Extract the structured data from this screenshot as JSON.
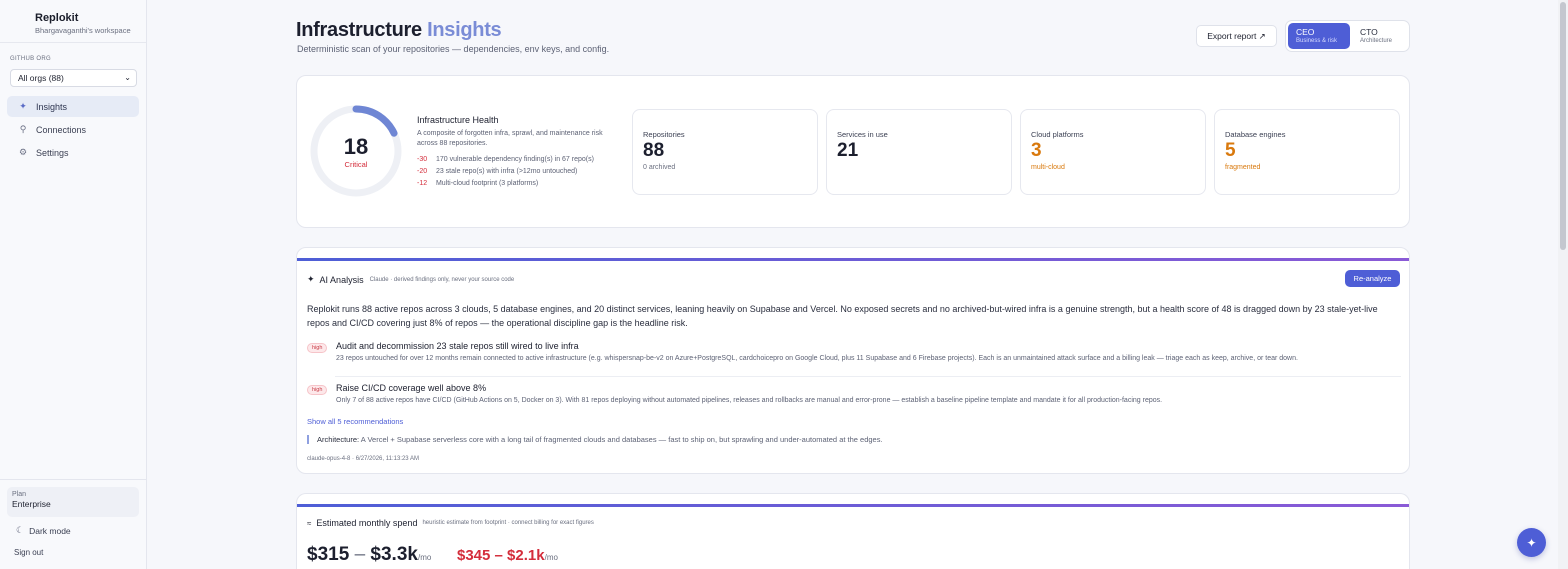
{
  "sidebar": {
    "brand_name": "Replokit",
    "workspace": "Bhargavaganthi's workspace",
    "org_label": "GITHUB ORG",
    "org_selected": "All orgs (88)",
    "nav": [
      {
        "label": "Insights",
        "icon": "sparkle-icon"
      },
      {
        "label": "Connections",
        "icon": "plug-icon"
      },
      {
        "label": "Settings",
        "icon": "gear-icon"
      }
    ],
    "plan_label": "Plan",
    "plan_value": "Enterprise",
    "dark_mode": "Dark mode",
    "sign_out": "Sign out"
  },
  "header": {
    "title_main": "Infrastructure",
    "title_accent": "Insights",
    "subtitle": "Deterministic scan of your repositories — dependencies, env keys, and config.",
    "export_label": "Export report ↗",
    "roles": [
      {
        "title": "CEO",
        "sub": "Business & risk",
        "active": true
      },
      {
        "title": "CTO",
        "sub": "Architecture",
        "active": false
      }
    ]
  },
  "health": {
    "score": 18,
    "score_max": 100,
    "status": "Critical",
    "title": "Infrastructure Health",
    "description": "A composite of forgotten infra, sprawl, and maintenance risk across 88 repositories.",
    "penalties": [
      {
        "points": "-30",
        "text": "170 vulnerable dependency finding(s) in 67 repo(s)"
      },
      {
        "points": "-20",
        "text": "23 stale repo(s) with infra (>12mo untouched)"
      },
      {
        "points": "-12",
        "text": "Multi-cloud footprint (3 platforms)"
      }
    ],
    "stats": [
      {
        "label": "Repositories",
        "value": "88",
        "note": "0 archived",
        "warn": false
      },
      {
        "label": "Services in use",
        "value": "21",
        "note": "",
        "warn": false
      },
      {
        "label": "Cloud platforms",
        "value": "3",
        "note": "multi-cloud",
        "warn": true
      },
      {
        "label": "Database engines",
        "value": "5",
        "note": "fragmented",
        "warn": true
      }
    ],
    "colors": {
      "critical": "#d42d3b",
      "gauge": "#6f86d4",
      "warn": "#d9790d"
    }
  },
  "ai": {
    "title": "AI Analysis",
    "subtitle": "Claude · derived findings only, never your source code",
    "reanalyze_label": "Re-analyze",
    "summary": "Replokit runs 88 active repos across 3 clouds, 5 database engines, and 20 distinct services, leaning heavily on Supabase and Vercel. No exposed secrets and no archived-but-wired infra is a genuine strength, but a health score of 48 is dragged down by 23 stale-yet-live repos and CI/CD covering just 8% of repos — the operational discipline gap is the headline risk.",
    "recommendations": [
      {
        "priority": "high",
        "title": "Audit and decommission 23 stale repos still wired to live infra",
        "detail": "23 repos untouched for over 12 months remain connected to active infrastructure (e.g. whispersnap-be-v2 on Azure+PostgreSQL, cardchoicepro on Google Cloud, plus 11 Supabase and 6 Firebase projects). Each is an unmaintained attack surface and a billing leak — triage each as keep, archive, or tear down."
      },
      {
        "priority": "high",
        "title": "Raise CI/CD coverage well above 8%",
        "detail": "Only 7 of 88 active repos have CI/CD (GitHub Actions on 5, Docker on 3). With 81 repos deploying without automated pipelines, releases and rollbacks are manual and error-prone — establish a baseline pipeline template and mandate it for all production-facing repos."
      }
    ],
    "show_all": "Show all 5 recommendations",
    "arch_label": "Architecture:",
    "arch_text": "A Vercel + Supabase serverless core with a long tail of fragmented clouds and databases — fast to ship on, but sprawling and under-automated at the edges.",
    "meta": "claude-opus-4-8 · 6/27/2026, 11:13:23 AM"
  },
  "spend": {
    "title": "Estimated monthly spend",
    "subtitle": "heuristic estimate from footprint · connect billing for exact figures",
    "range_low": "$315",
    "range_sep": "–",
    "range_high": "$3.3k",
    "per": "/mo",
    "alt_range": "$345 – $2.1k",
    "alt_per": "/mo"
  },
  "fab_icon": "sparkle-icon"
}
